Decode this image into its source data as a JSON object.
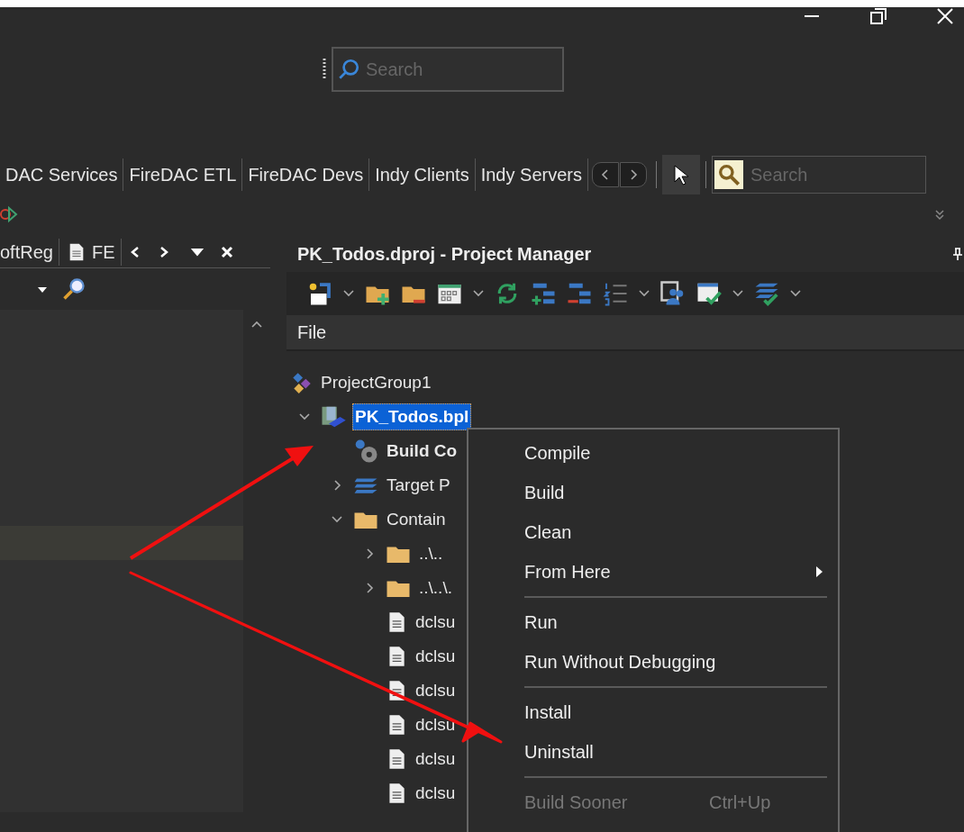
{
  "top_search": {
    "placeholder": "Search"
  },
  "palette": {
    "tabs": [
      {
        "label": "DAC Services",
        "selected": false
      },
      {
        "label": "FireDAC ETL",
        "selected": false
      },
      {
        "label": "FireDAC Devs",
        "selected": false
      },
      {
        "label": "Indy Clients",
        "selected": false
      },
      {
        "label": "Indy Servers",
        "selected": false
      }
    ],
    "search": {
      "placeholder": "Search"
    }
  },
  "left_panel": {
    "tabs": [
      {
        "label": "oftReg",
        "kind": "plain"
      },
      {
        "label": "FE",
        "kind": "document"
      }
    ]
  },
  "project_manager": {
    "title": "PK_Todos.dproj - Project Manager",
    "column": "File",
    "tree": [
      {
        "label": "ProjectGroup1",
        "kind": "group",
        "selected": false,
        "children": [
          {
            "label": "PK_Todos.bpl",
            "kind": "package",
            "expanded": true,
            "selected": true,
            "children": [
              {
                "label": "Build Co",
                "kind": "build",
                "bold": true,
                "selected": false
              },
              {
                "label": "Target P",
                "kind": "platforms",
                "expanded": false,
                "selected": false
              },
              {
                "label": "Contain",
                "kind": "folder",
                "expanded": true,
                "selected": false,
                "children": [
                  {
                    "label": "..\\..",
                    "kind": "folder",
                    "expanded": false,
                    "selected": false
                  },
                  {
                    "label": "..\\..\\.",
                    "kind": "folder",
                    "expanded": false,
                    "selected": false
                  },
                  {
                    "label": "dclsu",
                    "kind": "file",
                    "selected": false
                  },
                  {
                    "label": "dclsu",
                    "kind": "file",
                    "selected": false
                  },
                  {
                    "label": "dclsu",
                    "kind": "file",
                    "selected": false
                  },
                  {
                    "label": "dclsu",
                    "kind": "file",
                    "selected": false
                  },
                  {
                    "label": "dclsu",
                    "kind": "file",
                    "selected": false
                  },
                  {
                    "label": "dclsu",
                    "kind": "file",
                    "selected": false
                  }
                ]
              }
            ]
          }
        ]
      }
    ]
  },
  "context_menu": [
    {
      "kind": "item",
      "label": "Compile",
      "disabled": false
    },
    {
      "kind": "item",
      "label": "Build",
      "disabled": false
    },
    {
      "kind": "item",
      "label": "Clean",
      "disabled": false
    },
    {
      "kind": "submenu",
      "label": "From Here",
      "disabled": false
    },
    {
      "kind": "separator"
    },
    {
      "kind": "item",
      "label": "Run",
      "disabled": false
    },
    {
      "kind": "item",
      "label": "Run Without Debugging",
      "disabled": false
    },
    {
      "kind": "separator"
    },
    {
      "kind": "item",
      "label": "Install",
      "disabled": false
    },
    {
      "kind": "item",
      "label": "Uninstall",
      "disabled": false
    },
    {
      "kind": "separator"
    },
    {
      "kind": "item",
      "label": "Build Sooner",
      "shortcut": "Ctrl+Up",
      "disabled": true
    }
  ]
}
